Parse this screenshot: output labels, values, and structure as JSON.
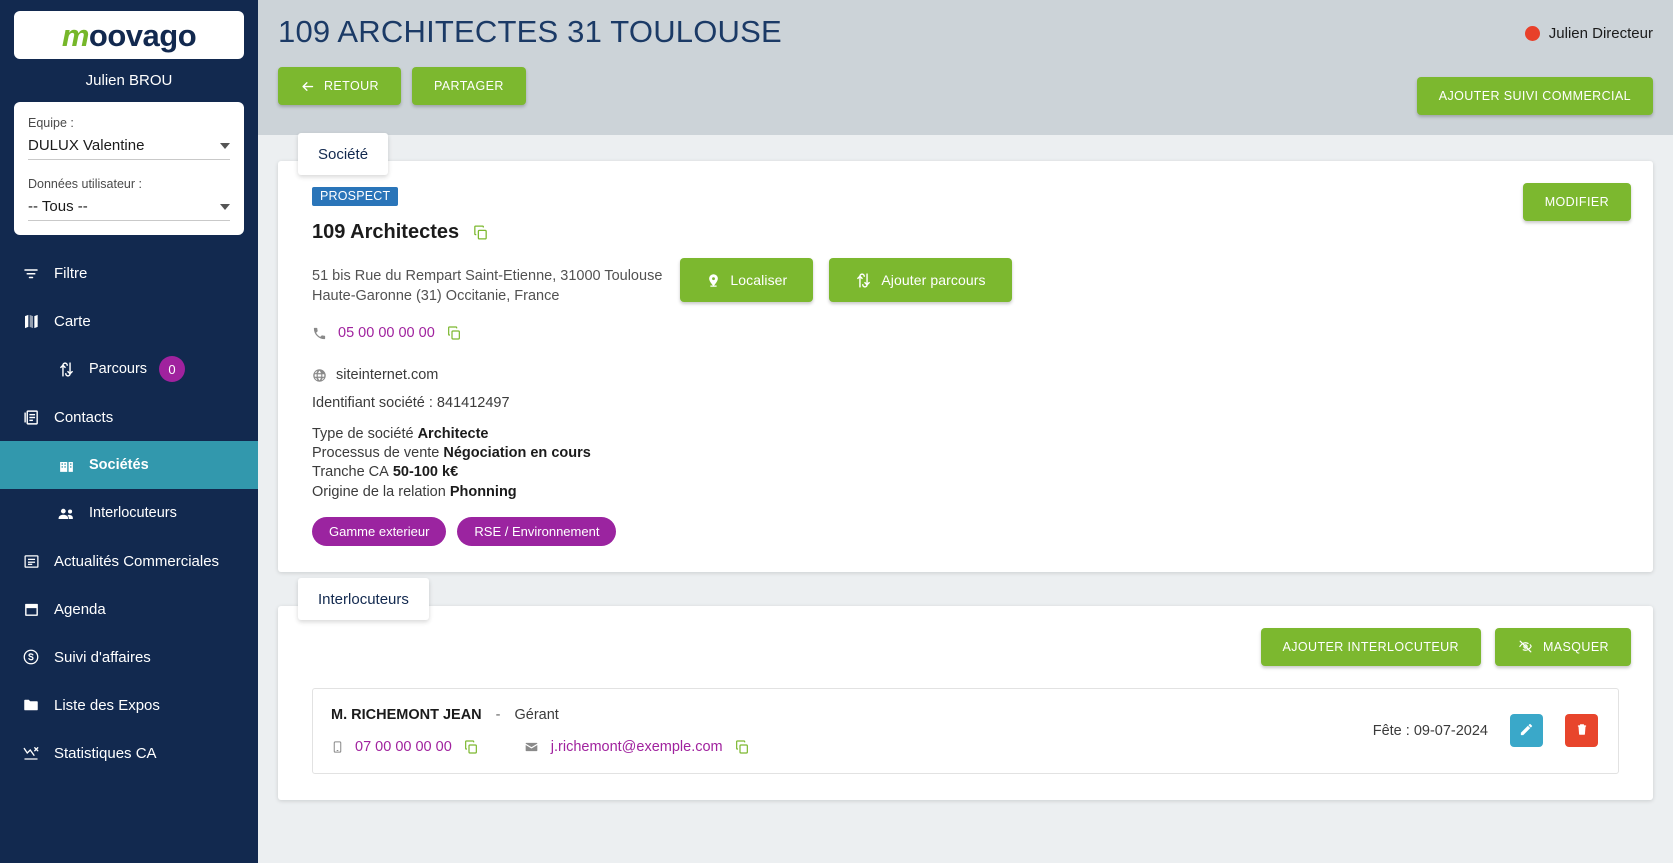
{
  "sidebar": {
    "logo": {
      "prefix": "m",
      "rest": "oovago"
    },
    "user_name": "Julien BROU",
    "filters": {
      "team_label": "Equipe :",
      "team_value": "DULUX Valentine",
      "userdata_label": "Données utilisateur :",
      "userdata_value": "-- Tous --"
    },
    "items": [
      {
        "label": "Filtre",
        "icon": "filter-icon",
        "sub": false,
        "active": false
      },
      {
        "label": "Carte",
        "icon": "map-icon",
        "sub": false,
        "active": false
      },
      {
        "label": "Parcours",
        "icon": "route-icon",
        "sub": true,
        "active": false,
        "badge": "0"
      },
      {
        "label": "Contacts",
        "icon": "contacts-icon",
        "sub": false,
        "active": false
      },
      {
        "label": "Sociétés",
        "icon": "building-icon",
        "sub": true,
        "active": true
      },
      {
        "label": "Interlocuteurs",
        "icon": "people-icon",
        "sub": true,
        "active": false
      },
      {
        "label": "Actualités Commerciales",
        "icon": "news-icon",
        "sub": false,
        "active": false
      },
      {
        "label": "Agenda",
        "icon": "calendar-icon",
        "sub": false,
        "active": false
      },
      {
        "label": "Suivi d'affaires",
        "icon": "deal-icon",
        "sub": false,
        "active": false
      },
      {
        "label": "Liste des Expos",
        "icon": "folder-icon",
        "sub": false,
        "active": false
      },
      {
        "label": "Statistiques CA",
        "icon": "chart-icon",
        "sub": false,
        "active": false
      }
    ]
  },
  "header": {
    "title": "109 ARCHITECTES 31 TOULOUSE",
    "back_label": "RETOUR",
    "share_label": "PARTAGER",
    "add_followup_label": "AJOUTER SUIVI COMMERCIAL",
    "account_name": "Julien Directeur",
    "status_color": "#e8402a"
  },
  "company": {
    "tab_label": "Société",
    "status_tag": "PROSPECT",
    "name": "109 Architectes",
    "address_line1": "51 bis Rue du Rempart Saint-Etienne, 31000 Toulouse",
    "address_line2": "Haute-Garonne (31) Occitanie, France",
    "locate_label": "Localiser",
    "add_route_label": "Ajouter parcours",
    "modify_label": "MODIFIER",
    "phone": "05 00 00 00 00",
    "website": "siteinternet.com",
    "identifier": "Identifiant société : 841412497",
    "fields": [
      {
        "label": "Type de société",
        "value": "Architecte"
      },
      {
        "label": "Processus de vente",
        "value": "Négociation en cours"
      },
      {
        "label": "Tranche CA",
        "value": "50-100 k€"
      },
      {
        "label": "Origine de la relation",
        "value": "Phonning"
      }
    ],
    "tags": [
      "Gamme exterieur",
      "RSE / Environnement"
    ]
  },
  "contacts_section": {
    "tab_label": "Interlocuteurs",
    "add_label": "AJOUTER INTERLOCUTEUR",
    "hide_label": "MASQUER",
    "rows": [
      {
        "name": "M. RICHEMONT JEAN",
        "separator": "-",
        "role": "Gérant",
        "phone": "07 00 00 00 00",
        "email": "j.richemont@exemple.com",
        "anniversary": "Fête : 09-07-2024"
      }
    ]
  },
  "colors": {
    "sidebar_bg": "#12294f",
    "accent_green": "#7cb82f",
    "active_teal": "#3298ad",
    "purple": "#9b24a0",
    "link_magenta": "#a0229e",
    "prospect_blue": "#2a75b9"
  }
}
